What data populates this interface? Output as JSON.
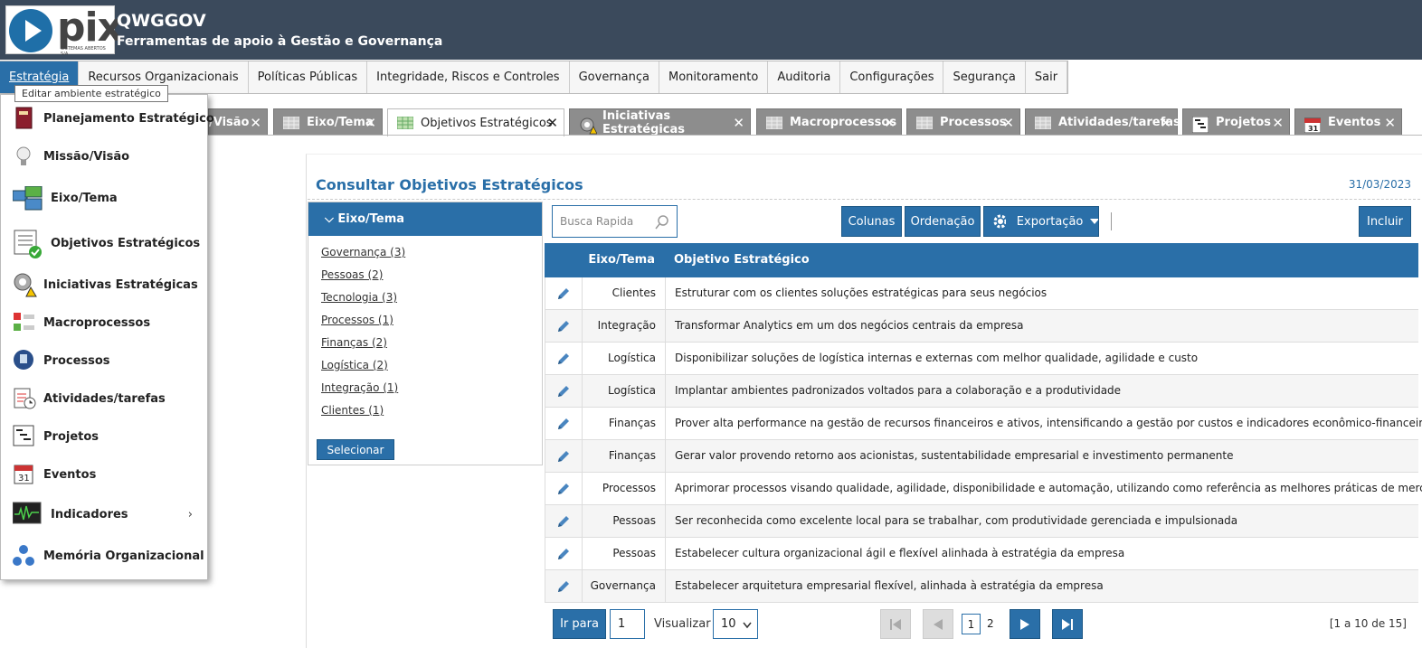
{
  "header": {
    "logo_text": "pix",
    "logo_sub": "SISTEMAS ABERTOS S/A",
    "title": "QWGGOV",
    "subtitle": "Ferramentas de apoio à Gestão e Governança"
  },
  "menu": [
    "Estratégia",
    "Recursos Organizacionais",
    "Políticas Públicas",
    "Integridade, Riscos e Controles",
    "Governança",
    "Monitoramento",
    "Auditoria",
    "Configurações",
    "Segurança",
    "Sair"
  ],
  "tooltip": "Editar ambiente estratégico",
  "dropdown": {
    "items": [
      "Planejamento Estratégico",
      "Missão/Visão",
      "Eixo/Tema",
      "Objetivos Estratégicos",
      "Iniciativas Estratégicas",
      "Macroprocessos",
      "Processos",
      "Atividades/tarefas",
      "Projetos",
      "Eventos",
      "Indicadores",
      "Memória Organizacional"
    ],
    "submenu_arrow": "›"
  },
  "tabs": [
    "/Visão",
    "Eixo/Tema",
    "Objetivos Estratégicos",
    "Iniciativas Estratégicas",
    "Macroprocessos",
    "Processos",
    "Atividades/tarefas",
    "Projetos",
    "Eventos"
  ],
  "tab_close": "✕",
  "page": {
    "title": "Consultar Objetivos Estratégicos",
    "date": "31/03/2023"
  },
  "filter": {
    "header": "Eixo/Tema",
    "items": [
      "Governança (3)",
      "Pessoas (2)",
      "Tecnologia (3)",
      "Processos (1)",
      "Finanças (2)",
      "Logística (2)",
      "Integração (1)",
      "Clientes (1)"
    ],
    "select_button": "Selecionar"
  },
  "toolbar": {
    "search_placeholder": "Busca Rapida",
    "columns": "Colunas",
    "ordering": "Ordenação",
    "export": "Exportação",
    "include": "Incluir"
  },
  "table": {
    "headers": [
      "Eixo/Tema",
      "Objetivo Estratégico"
    ],
    "rows": [
      [
        "Clientes",
        "Estruturar com os clientes soluções estratégicas para seus negócios"
      ],
      [
        "Integração",
        "Transformar Analytics em um dos negócios centrais da empresa"
      ],
      [
        "Logística",
        "Disponibilizar soluções de logística internas e externas com melhor qualidade, agilidade e custo"
      ],
      [
        "Logística",
        "Implantar ambientes padronizados voltados para a colaboração e a produtividade"
      ],
      [
        "Finanças",
        "Prover alta performance na gestão de recursos financeiros e ativos, intensificando a gestão por custos e indicadores econômico-financeiros"
      ],
      [
        "Finanças",
        "Gerar valor provendo retorno aos acionistas, sustentabilidade empresarial e investimento permanente"
      ],
      [
        "Processos",
        "Aprimorar processos visando qualidade, agilidade, disponibilidade e automação, utilizando como referência as melhores práticas de mercado"
      ],
      [
        "Pessoas",
        "Ser reconhecida como excelente local para se trabalhar, com produtividade gerenciada e impulsionada"
      ],
      [
        "Pessoas",
        "Estabelecer cultura organizacional ágil e flexível alinhada à estratégia da empresa"
      ],
      [
        "Governança",
        "Estabelecer arquitetura empresarial flexível, alinhada à estratégia da empresa"
      ]
    ]
  },
  "pager": {
    "goto_label": "Ir para",
    "goto_value": "1",
    "view_label": "Visualizar",
    "view_value": "10",
    "page_current": "1",
    "page_next": "2",
    "range": "[1 a 10 de 15]"
  },
  "colors": {
    "accent": "#2a6fa8",
    "header_bg": "#3b4a5c"
  }
}
